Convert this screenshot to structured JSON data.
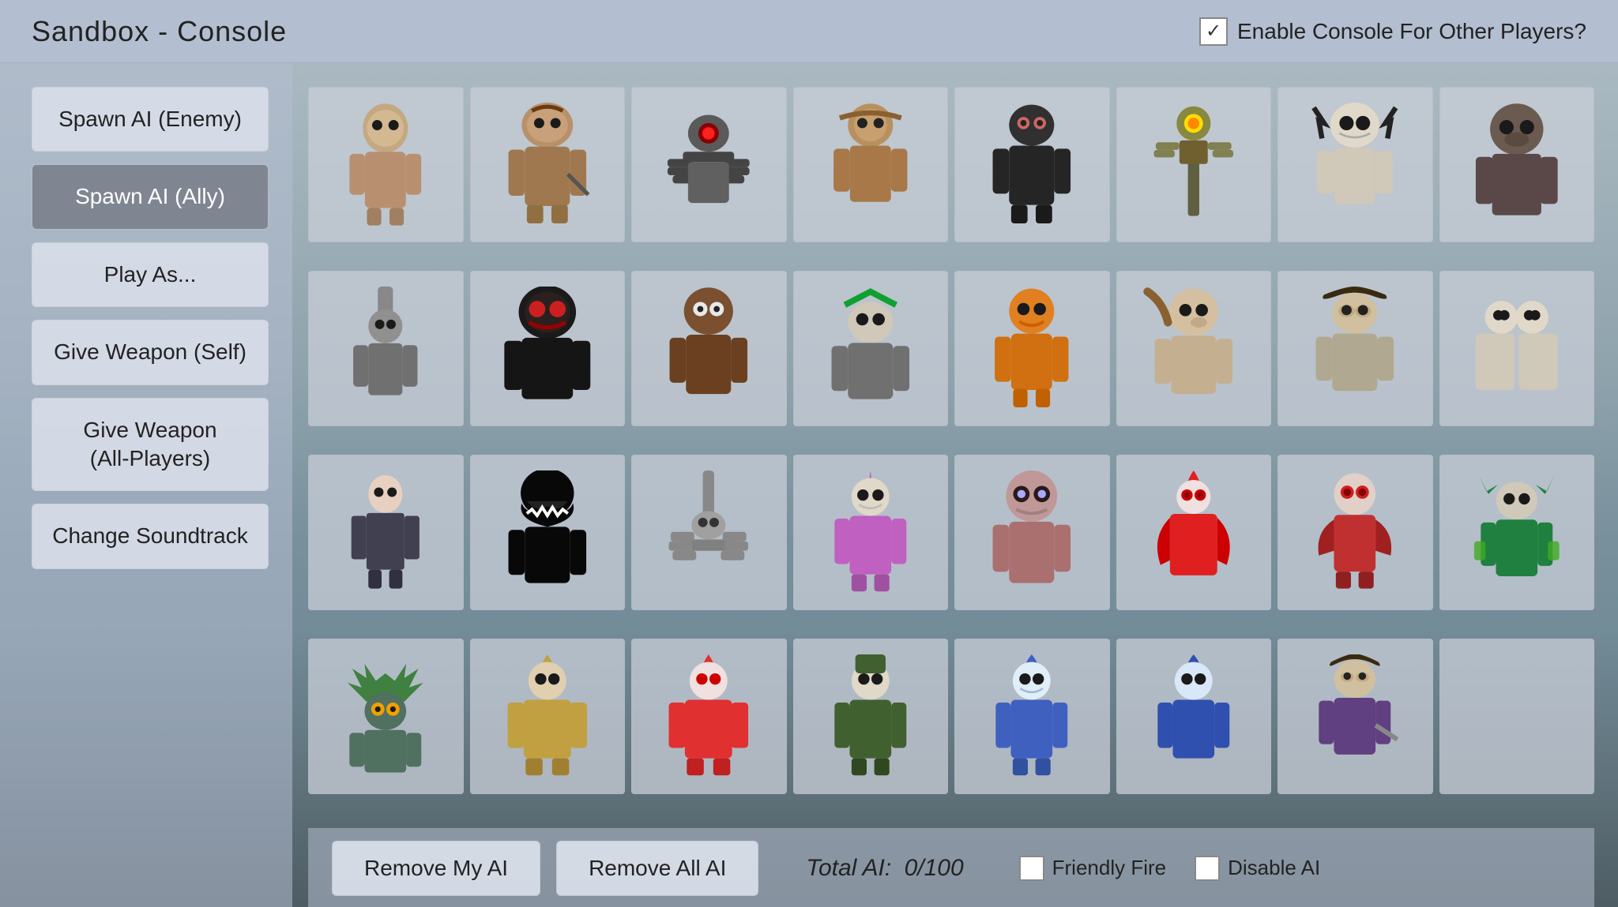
{
  "header": {
    "title": "Sandbox - Console",
    "checkbox_label": "Enable Console For Other Players?",
    "checked": true
  },
  "sidebar": {
    "buttons": [
      {
        "id": "spawn-enemy",
        "label": "Spawn AI (Enemy)",
        "active": false
      },
      {
        "id": "spawn-ally",
        "label": "Spawn AI (Ally)",
        "active": true
      },
      {
        "id": "play-as",
        "label": "Play As...",
        "active": false
      },
      {
        "id": "give-weapon-self",
        "label": "Give Weapon (Self)",
        "active": false
      },
      {
        "id": "give-weapon-all",
        "label": "Give Weapon\n(All-Players)",
        "active": false
      },
      {
        "id": "change-soundtrack",
        "label": "Change Soundtrack",
        "active": false
      }
    ]
  },
  "grid": {
    "rows": 4,
    "cols": 8,
    "characters": [
      {
        "id": 1,
        "color": "#c4a882",
        "type": "humanoid-pale"
      },
      {
        "id": 2,
        "color": "#b8906a",
        "type": "humanoid-large"
      },
      {
        "id": 3,
        "color": "#5a5a5a",
        "type": "robot-spider"
      },
      {
        "id": 4,
        "color": "#b89060",
        "type": "humanoid-monkey"
      },
      {
        "id": 5,
        "color": "#404040",
        "type": "humanoid-dark"
      },
      {
        "id": 6,
        "color": "#888840",
        "type": "robot-tall"
      },
      {
        "id": 7,
        "color": "#e0d8c8",
        "type": "humanoid-white"
      },
      {
        "id": 8,
        "color": "#6a5a50",
        "type": "humanoid-stocky"
      },
      {
        "id": 9,
        "color": "#808080",
        "type": "humanoid-grey"
      },
      {
        "id": 10,
        "color": "#2a2a2a",
        "type": "humanoid-dark2"
      },
      {
        "id": 11,
        "color": "#7a5030",
        "type": "humanoid-brown"
      },
      {
        "id": 12,
        "color": "#208040",
        "type": "humanoid-green-hair"
      },
      {
        "id": 13,
        "color": "#e08020",
        "type": "humanoid-orange"
      },
      {
        "id": 14,
        "color": "#d4c0a0",
        "type": "humanoid-spotted"
      },
      {
        "id": 15,
        "color": "#a07050",
        "type": "humanoid-cow"
      },
      {
        "id": 16,
        "color": "#e0d8c8",
        "type": "humanoid-white2"
      },
      {
        "id": 17,
        "color": "#404850",
        "type": "humanoid-dark3"
      },
      {
        "id": 18,
        "color": "#101010",
        "type": "shadow-creature"
      },
      {
        "id": 19,
        "color": "#a0a0a0",
        "type": "robot-bird"
      },
      {
        "id": 20,
        "color": "#c060c0",
        "type": "humanoid-purple"
      },
      {
        "id": 21,
        "color": "#8a6070",
        "type": "humanoid-pale2"
      },
      {
        "id": 22,
        "color": "#e02020",
        "type": "humanoid-red"
      },
      {
        "id": 23,
        "color": "#c03030",
        "type": "humanoid-red2"
      },
      {
        "id": 24,
        "color": "#408020",
        "type": "humanoid-green2"
      },
      {
        "id": 25,
        "color": "#408040",
        "type": "dragon-green"
      },
      {
        "id": 26,
        "color": "#c0a040",
        "type": "humanoid-yellow"
      },
      {
        "id": 27,
        "color": "#e03030",
        "type": "humanoid-red3"
      },
      {
        "id": 28,
        "color": "#406030",
        "type": "humanoid-dark-green"
      },
      {
        "id": 29,
        "color": "#4060c0",
        "type": "humanoid-blue"
      },
      {
        "id": 30,
        "color": "#3050b0",
        "type": "humanoid-blue2"
      },
      {
        "id": 31,
        "color": "#604080",
        "type": "humanoid-cow2"
      },
      {
        "id": 32,
        "color": "#888888",
        "type": "empty"
      }
    ]
  },
  "bottom_bar": {
    "remove_my_ai": "Remove My AI",
    "remove_all_ai": "Remove All AI",
    "total_ai_label": "Total AI:",
    "total_ai_value": "0/100",
    "friendly_fire_label": "Friendly Fire",
    "disable_ai_label": "Disable AI"
  },
  "icons": {
    "checkmark": "✓"
  }
}
